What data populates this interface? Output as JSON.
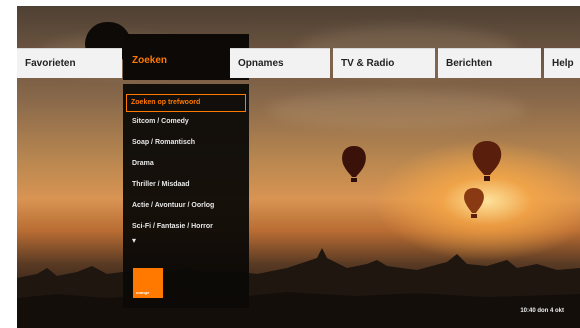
{
  "menu": {
    "tabs": [
      {
        "label": "Favorieten"
      },
      {
        "label": "Zoeken"
      },
      {
        "label": "Opnames"
      },
      {
        "label": "TV & Radio"
      },
      {
        "label": "Berichten"
      },
      {
        "label": "Help"
      }
    ],
    "active_index": 1
  },
  "dropdown": {
    "items": [
      {
        "label": "Zoeken op trefwoord"
      },
      {
        "label": "Sitcom / Comedy"
      },
      {
        "label": "Soap / Romantisch"
      },
      {
        "label": "Drama"
      },
      {
        "label": "Thriller / Misdaad"
      },
      {
        "label": "Actie / Avontuur / Oorlog"
      },
      {
        "label": "Sci-Fi / Fantasie / Horror"
      }
    ],
    "more_icon": "chevron-down-icon",
    "logo_text": "orange"
  },
  "status": {
    "clock": "10:40  don 4 okt"
  },
  "colors": {
    "accent": "#ff7900",
    "menu_bg": "#f2f2f2",
    "panel_bg": "#0c0907"
  }
}
